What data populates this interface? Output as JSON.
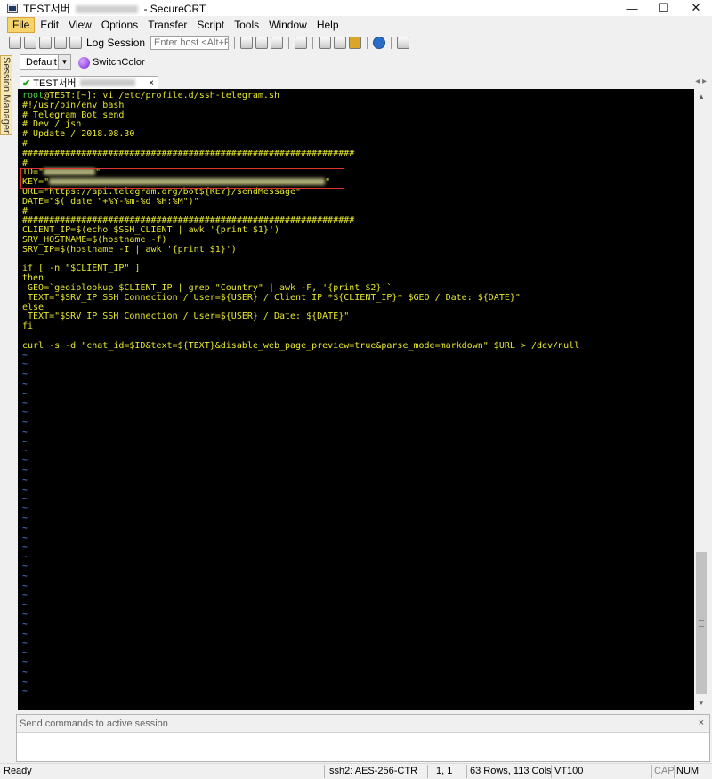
{
  "titlebar": {
    "tab_name": "TEST서버",
    "app_name": "- SecureCRT",
    "minimize": "—",
    "maximize": "☐",
    "close": "✕"
  },
  "menu": [
    {
      "label": "File",
      "active": true
    },
    {
      "label": "Edit"
    },
    {
      "label": "View"
    },
    {
      "label": "Options"
    },
    {
      "label": "Transfer"
    },
    {
      "label": "Script"
    },
    {
      "label": "Tools"
    },
    {
      "label": "Window"
    },
    {
      "label": "Help"
    }
  ],
  "toolbar": {
    "log_session": "Log Session",
    "host_placeholder": "Enter host <Alt+R>"
  },
  "buttonbar": {
    "selected": "Default",
    "switch_color": "SwitchColor"
  },
  "session_manager": {
    "label": "Session Manager"
  },
  "tab": {
    "label": "TEST서버",
    "close": "×"
  },
  "terminal": {
    "lines": [
      [
        {
          "t": "root",
          "c": "green"
        },
        {
          "t": "@TEST:[~]: vi /etc/profile.d/ssh-telegram.sh",
          "c": "yellow"
        }
      ],
      [
        {
          "t": "#!/usr/bin/env bash",
          "c": "yellow"
        }
      ],
      [
        {
          "t": "# Telegram Bot send",
          "c": "yellow"
        }
      ],
      [
        {
          "t": "# Dev / jsh",
          "c": "yellow"
        }
      ],
      [
        {
          "t": "# Update / 2018.08.30",
          "c": "yellow"
        }
      ],
      [
        {
          "t": "#",
          "c": "yellow"
        }
      ],
      [
        {
          "t": "##############################################################",
          "c": "yellow"
        }
      ],
      [
        {
          "t": "#",
          "c": "yellow"
        }
      ],
      [
        {
          "t": "ID=\"",
          "c": "yellow"
        },
        {
          "blur": 58
        },
        {
          "t": "\"",
          "c": "yellow"
        }
      ],
      [
        {
          "t": "KEY=\"",
          "c": "yellow"
        },
        {
          "blur": 310
        },
        {
          "t": "\"",
          "c": "yellow"
        }
      ],
      [
        {
          "t": "URL=\"https://api.telegram.org/bot${KEY}/sendMessage\"",
          "c": "yellow"
        }
      ],
      [
        {
          "t": "DATE=\"$( date \"+%Y-%m-%d %H:%M\")\"",
          "c": "yellow"
        }
      ],
      [
        {
          "t": "#",
          "c": "yellow"
        }
      ],
      [
        {
          "t": "##############################################################",
          "c": "yellow"
        }
      ],
      [
        {
          "t": "CLIENT_IP=$(echo $SSH_CLIENT | awk '{print $1}')",
          "c": "yellow"
        }
      ],
      [
        {
          "t": "SRV_HOSTNAME=$(hostname -f)",
          "c": "yellow"
        }
      ],
      [
        {
          "t": "SRV_IP=$(hostname -I | awk '{print $1}')",
          "c": "yellow"
        }
      ],
      [
        {
          "t": "",
          "c": "yellow"
        }
      ],
      [
        {
          "t": "if [ -n \"$CLIENT_IP\" ]",
          "c": "yellow"
        }
      ],
      [
        {
          "t": "then",
          "c": "yellow"
        }
      ],
      [
        {
          "t": " GEO=`geoiplookup $CLIENT_IP | grep \"Country\" | awk -F, '{print $2}'`",
          "c": "yellow"
        }
      ],
      [
        {
          "t": " TEXT=\"$SRV_IP SSH Connection / User=${USER} / Client IP *${CLIENT_IP}* $GEO / Date: ${DATE}\"",
          "c": "yellow"
        }
      ],
      [
        {
          "t": "else",
          "c": "yellow"
        }
      ],
      [
        {
          "t": " TEXT=\"$SRV_IP SSH Connection / User=${USER} / Date: ${DATE}\"",
          "c": "yellow"
        }
      ],
      [
        {
          "t": "fi",
          "c": "yellow"
        }
      ],
      [
        {
          "t": "",
          "c": "yellow"
        }
      ],
      [
        {
          "t": "curl -s -d \"chat_id=$ID&text=${TEXT}&disable_web_page_preview=true&parse_mode=markdown\" $URL > /dev/null",
          "c": "yellow"
        }
      ]
    ],
    "tilde_count": 36,
    "tilde": "~"
  },
  "command_window": {
    "title": "Send commands to active session",
    "close": "×"
  },
  "statusbar": {
    "ready": "Ready",
    "cipher": "ssh2: AES-256-CTR",
    "position": "1,   1",
    "size": "63 Rows, 113 Cols",
    "emulation": "VT100",
    "cap": "CAP",
    "num": "NUM"
  },
  "colors": {
    "green": "#4bd24b",
    "yellow": "#e6e62c",
    "white": "#e8e8e8",
    "blue": "#5a84ff",
    "highlight_box": "#e0342b"
  }
}
